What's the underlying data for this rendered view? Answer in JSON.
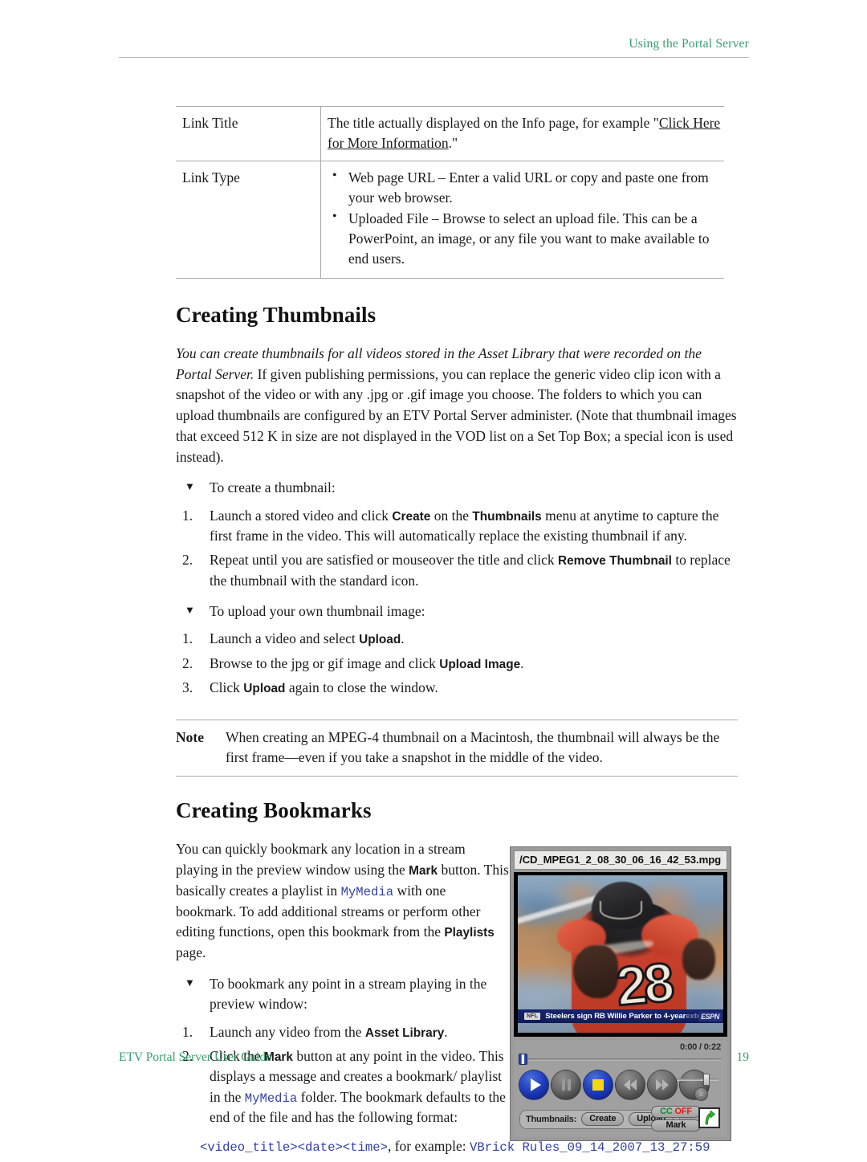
{
  "header": {
    "running_title": "Using the Portal Server"
  },
  "table": {
    "rows": [
      {
        "label": "Link Title",
        "desc_pre": "The title actually displayed on the Info page, for example \"",
        "desc_link": "Click Here for More Information",
        "desc_post": ".\""
      },
      {
        "label": "Link Type",
        "bullets": [
          "Web page URL – Enter a valid URL or copy and paste one from your web browser.",
          "Uploaded File – Browse to select an upload file. This can be a PowerPoint, an image, or any file you want to make available to end users."
        ]
      }
    ]
  },
  "thumbnails_section": {
    "title": "Creating Thumbnails",
    "intro_italic": "You can create thumbnails for all videos stored in the Asset Library that were recorded on the Portal Server.",
    "intro_rest": " If given publishing permissions, you can replace the generic video clip icon with a snapshot of the video or with any .jpg or .gif image you choose. The folders to which you can upload thumbnails are configured by an ETV Portal Server administer. (Note that thumbnail images that exceed 512 K in size are not displayed in the VOD list on a Set Top Box; a special icon is used instead).",
    "proc1_heading": "To create a thumbnail:",
    "proc1_steps": [
      {
        "num": "1.",
        "parts": [
          {
            "t": "Launch a stored video and click ",
            "s": "plain"
          },
          {
            "t": "Create",
            "s": "ui"
          },
          {
            "t": " on the ",
            "s": "plain"
          },
          {
            "t": "Thumbnails",
            "s": "ui"
          },
          {
            "t": " menu at anytime to capture the first frame in the video. This will automatically replace the existing thumbnail if any.",
            "s": "plain"
          }
        ]
      },
      {
        "num": "2.",
        "parts": [
          {
            "t": "Repeat until you are satisfied or mouseover the title and click ",
            "s": "plain"
          },
          {
            "t": "Remove Thumbnail",
            "s": "ui"
          },
          {
            "t": " to replace the thumbnail with the standard icon.",
            "s": "plain"
          }
        ]
      }
    ],
    "proc2_heading": "To upload your own thumbnail image:",
    "proc2_steps": [
      {
        "num": "1.",
        "parts": [
          {
            "t": "Launch a video and select ",
            "s": "plain"
          },
          {
            "t": "Upload",
            "s": "ui"
          },
          {
            "t": ".",
            "s": "plain"
          }
        ]
      },
      {
        "num": "2.",
        "parts": [
          {
            "t": "Browse to the jpg or gif image and click ",
            "s": "plain"
          },
          {
            "t": "Upload Image",
            "s": "ui"
          },
          {
            "t": ".",
            "s": "plain"
          }
        ]
      },
      {
        "num": "3.",
        "parts": [
          {
            "t": "Click ",
            "s": "plain"
          },
          {
            "t": "Upload",
            "s": "ui"
          },
          {
            "t": " again to close the window.",
            "s": "plain"
          }
        ]
      }
    ],
    "note_label": "Note",
    "note_text": "When creating an MPEG-4 thumbnail on a Macintosh, the thumbnail will always be the first frame—even if you take a snapshot in the middle of the video."
  },
  "bookmarks_section": {
    "title": "Creating Bookmarks",
    "intro_parts": [
      {
        "t": "You can quickly bookmark any location in a stream playing in the preview window using the ",
        "s": "plain"
      },
      {
        "t": "Mark",
        "s": "ui"
      },
      {
        "t": " button. This basically creates a playlist in ",
        "s": "plain"
      },
      {
        "t": "MyMedia",
        "s": "xref"
      },
      {
        "t": " with one bookmark. To add additional streams or perform other editing functions, open this bookmark from the ",
        "s": "plain"
      },
      {
        "t": "Playlists",
        "s": "ui"
      },
      {
        "t": " page.",
        "s": "plain"
      }
    ],
    "proc_heading": "To bookmark any point in a stream playing in the preview window:",
    "proc_steps": [
      {
        "num": "1.",
        "parts": [
          {
            "t": "Launch any video from the ",
            "s": "plain"
          },
          {
            "t": "Asset Library",
            "s": "ui"
          },
          {
            "t": ".",
            "s": "plain"
          }
        ]
      },
      {
        "num": "2.",
        "parts": [
          {
            "t": "Click the ",
            "s": "plain"
          },
          {
            "t": "Mark",
            "s": "ui"
          },
          {
            "t": " button at any point in the video. This displays a message and creates a bookmark/ playlist in the ",
            "s": "plain"
          },
          {
            "t": "MyMedia",
            "s": "xref"
          },
          {
            "t": " folder. The bookmark defaults to the end of the file and has the following format:",
            "s": "plain"
          }
        ]
      }
    ],
    "format_parts": [
      {
        "t": "<video_title><date><time>",
        "s": "code"
      },
      {
        "t": ", for example: ",
        "s": "plain"
      },
      {
        "t": "VBrick Rules_09_14_2007_13_27:59",
        "s": "code"
      }
    ]
  },
  "player": {
    "title": "/CD_MPEG1_2_08_30_06_16_42_53.mpg",
    "ticker": {
      "logo": "NFL",
      "text": "Steelers sign RB Willie Parker to 4-year",
      "text_faded": " exte...",
      "network": "ESPN"
    },
    "time": "0:00 / 0:22",
    "buttons": {
      "play": "play-button",
      "pause": "pause-button",
      "stop": "stop-button",
      "rewind": "rewind-button",
      "forward": "fast-forward-button",
      "full": "FULL"
    },
    "thumbnails_label": "Thumbnails:",
    "create_label": "Create",
    "upload_label": "Upload",
    "cc_label": "CC",
    "cc_state": "OFF",
    "mark_label": "Mark"
  },
  "footer": {
    "guide_title": "ETV Portal Server User Guide",
    "page_number": "19"
  },
  "colors": {
    "accent_green": "#35a06b",
    "xref_blue": "#2f3fa8",
    "cc_on_green": "#0a8a2a",
    "cc_off_red": "#e11b12"
  }
}
